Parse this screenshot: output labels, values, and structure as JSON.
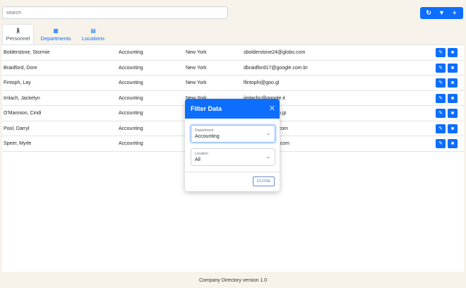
{
  "search": {
    "placeholder": "search"
  },
  "toolbar": {
    "refresh_icon": "refresh-icon",
    "filter_icon": "filter-icon",
    "add_icon": "plus-icon",
    "accent": "#0d6efd"
  },
  "tabs": [
    {
      "label": "Personnel",
      "icon": "person-icon",
      "active": true
    },
    {
      "label": "Departments",
      "icon": "building-icon",
      "active": false
    },
    {
      "label": "Locations",
      "icon": "map-icon",
      "active": false
    }
  ],
  "rows": [
    {
      "name": "Bolderstone, Stormie",
      "department": "Accounting",
      "location": "New York",
      "email": "sbolderstone24@globo.com"
    },
    {
      "name": "Braidford, Dore",
      "department": "Accounting",
      "location": "New York",
      "email": "dbraidford17@google.com.br"
    },
    {
      "name": "Fintoph, Lay",
      "department": "Accounting",
      "location": "New York",
      "email": "lfintophi@goo.gl"
    },
    {
      "name": "Imlach, Jackelyn",
      "department": "Accounting",
      "location": "New York",
      "email": "jimlachc@google.it"
    },
    {
      "name": "O'Mannion, Cindi",
      "department": "Accounting",
      "location": "",
      "email": "ameblo.jp"
    },
    {
      "name": "Pool, Darryl",
      "department": "Accounting",
      "location": "",
      "email": "rint.com"
    },
    {
      "name": "Speer, Myrle",
      "department": "Accounting",
      "location": "",
      "email": "od.com"
    }
  ],
  "modal": {
    "title": "Filter Data",
    "close_icon": "close-icon",
    "department": {
      "label": "Department",
      "value": "Accounting"
    },
    "location": {
      "label": "Location",
      "value": "All"
    },
    "close_label": "CLOSE"
  },
  "footer": {
    "text": "Company Directory version 1.0"
  }
}
